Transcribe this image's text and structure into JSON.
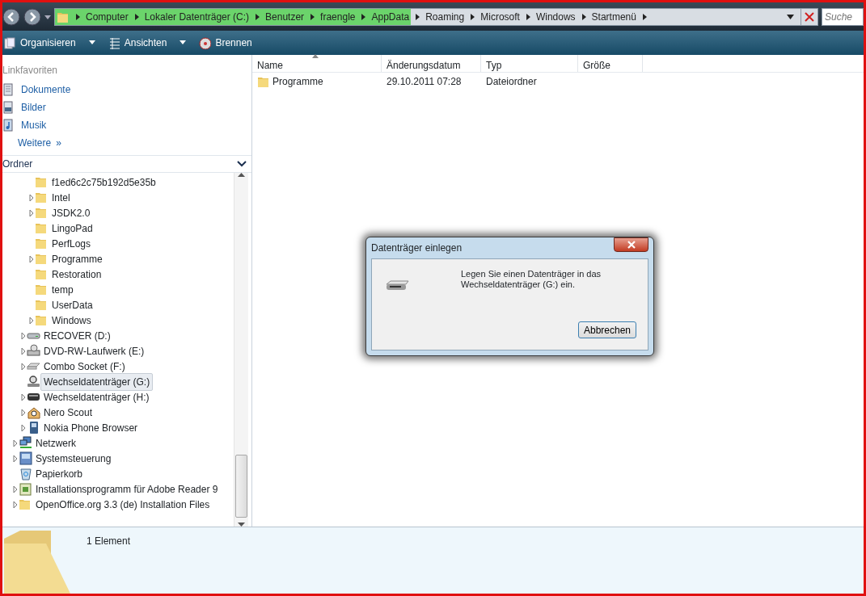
{
  "address_bar": {
    "segments": [
      {
        "label": "Computer",
        "highlighted": true
      },
      {
        "label": "Lokaler Datenträger (C:)",
        "highlighted": true
      },
      {
        "label": "Benutzer",
        "highlighted": true
      },
      {
        "label": "fraengle",
        "highlighted": true
      },
      {
        "label": "AppData",
        "highlighted": true
      },
      {
        "label": "Roaming",
        "highlighted": false
      },
      {
        "label": "Microsoft",
        "highlighted": false
      },
      {
        "label": "Windows",
        "highlighted": false
      },
      {
        "label": "Startmenü",
        "highlighted": false
      }
    ],
    "search_placeholder": "Suche"
  },
  "toolbar": [
    {
      "label": "Organisieren",
      "kind": "menu"
    },
    {
      "label": "Ansichten",
      "kind": "menu"
    },
    {
      "label": "Brennen",
      "kind": "action"
    }
  ],
  "favorites": {
    "title": "Linkfavoriten",
    "links": [
      {
        "label": "Dokumente",
        "kind": "documents"
      },
      {
        "label": "Bilder",
        "kind": "pictures"
      },
      {
        "label": "Musik",
        "kind": "music"
      }
    ],
    "more": "Weitere",
    "more_chevron": "»"
  },
  "folders_header": "Ordner",
  "tree": [
    {
      "children": [
        {
          "children": [
            {
              "label": "f1ed6c2c75b192d5e35b",
              "kind": "folder",
              "expandable": false,
              "selected": false
            },
            {
              "label": "Intel",
              "kind": "folder",
              "expandable": true,
              "selected": false
            },
            {
              "label": "JSDK2.0",
              "kind": "folder",
              "expandable": true,
              "selected": false
            },
            {
              "label": "LingoPad",
              "kind": "folder",
              "expandable": false,
              "selected": false
            },
            {
              "label": "PerfLogs",
              "kind": "folder",
              "expandable": false,
              "selected": false
            },
            {
              "label": "Programme",
              "kind": "folder",
              "expandable": true,
              "selected": false
            },
            {
              "label": "Restoration",
              "kind": "folder",
              "expandable": false,
              "selected": false
            },
            {
              "label": "temp",
              "kind": "folder",
              "expandable": false,
              "selected": false
            },
            {
              "label": "UserData",
              "kind": "folder",
              "expandable": false,
              "selected": false
            },
            {
              "label": "Windows",
              "kind": "folder",
              "expandable": true,
              "selected": false
            }
          ]
        },
        {
          "label": "RECOVER (D:)",
          "kind": "drive",
          "expandable": true,
          "selected": false
        },
        {
          "label": "DVD-RW-Laufwerk (E:)",
          "kind": "dvd",
          "expandable": true,
          "selected": false
        },
        {
          "label": "Combo Socket (F:)",
          "kind": "socket",
          "expandable": true,
          "selected": false
        },
        {
          "label": "Wechseldatenträger (G:)",
          "kind": "scanner",
          "expandable": false,
          "selected": true
        },
        {
          "label": "Wechseldatenträger (H:)",
          "kind": "removable",
          "expandable": true,
          "selected": false
        },
        {
          "label": "Nero Scout",
          "kind": "house",
          "expandable": true,
          "selected": false
        },
        {
          "label": "Nokia Phone Browser",
          "kind": "phone",
          "expandable": true,
          "selected": false
        }
      ]
    },
    {
      "label": "Netzwerk",
      "kind": "network",
      "expandable": true,
      "selected": false
    },
    {
      "label": "Systemsteuerung",
      "kind": "control",
      "expandable": true,
      "selected": false
    },
    {
      "label": "Papierkorb",
      "kind": "bin",
      "expandable": false,
      "selected": false
    },
    {
      "label": "Installationsprogramm für Adobe Reader 9",
      "kind": "installer",
      "expandable": true,
      "selected": false
    },
    {
      "label": "OpenOffice.org 3.3 (de) Installation Files",
      "kind": "folder",
      "expandable": true,
      "selected": false
    }
  ],
  "file_list": {
    "columns": [
      "Name",
      "Änderungsdatum",
      "Typ",
      "Größe"
    ],
    "rows": [
      {
        "name": "Programme",
        "modified": "29.10.2011 07:28",
        "type": "Dateiordner"
      }
    ]
  },
  "dialog": {
    "title": "Datenträger einlegen",
    "message": "Legen Sie einen Datenträger in das Wechseldatenträger (G:) ein.",
    "buttons": [
      "Abbrechen"
    ]
  },
  "status_bar": {
    "text": "1 Element"
  }
}
